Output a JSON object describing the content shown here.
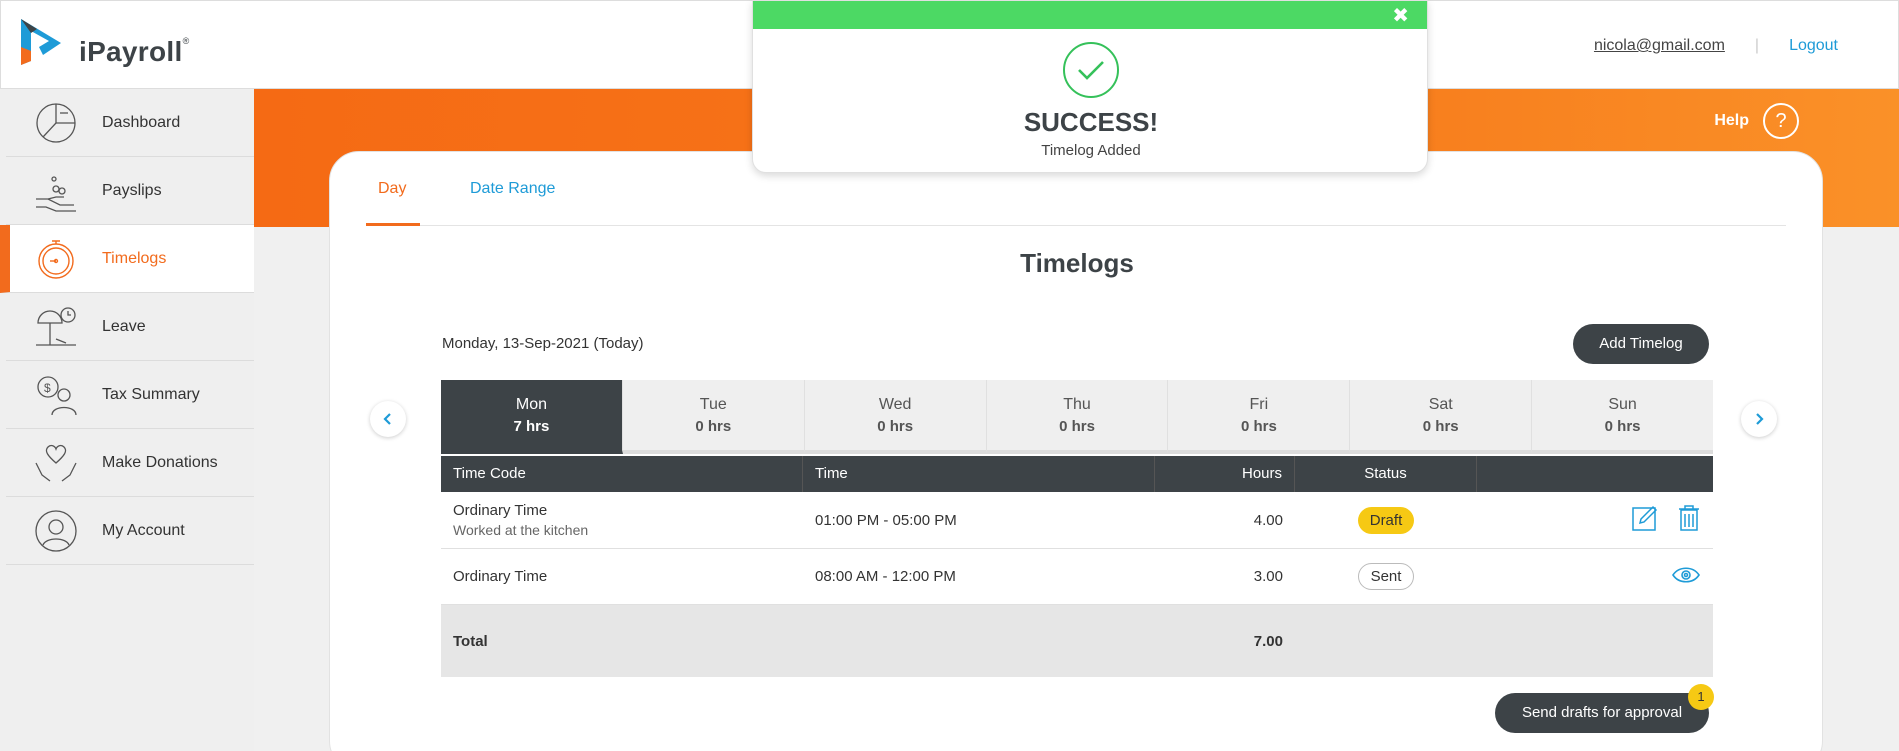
{
  "header": {
    "logo_text": "iPayroll",
    "logo_mark": "®",
    "email": "nicola@gmail.com",
    "separator": "|",
    "logout": "Logout"
  },
  "sidebar": {
    "items": [
      {
        "label": "Dashboard",
        "icon": "pie-chart-icon"
      },
      {
        "label": "Payslips",
        "icon": "hand-coins-icon"
      },
      {
        "label": "Timelogs",
        "icon": "stopwatch-icon",
        "active": true
      },
      {
        "label": "Leave",
        "icon": "beach-umbrella-icon"
      },
      {
        "label": "Tax Summary",
        "icon": "tax-person-icon"
      },
      {
        "label": "Make Donations",
        "icon": "heart-hands-icon"
      },
      {
        "label": "My Account",
        "icon": "user-circle-icon"
      }
    ]
  },
  "banner": {
    "help": "Help",
    "help_icon": "?"
  },
  "tabs": {
    "day": "Day",
    "date_range": "Date Range"
  },
  "main": {
    "title": "Timelogs",
    "date": "Monday, 13-Sep-2021 (Today)",
    "add_button": "Add Timelog",
    "prev_arrow": "‹",
    "next_arrow": "›"
  },
  "week": [
    {
      "day": "Mon",
      "hrs": "7 hrs",
      "active": true
    },
    {
      "day": "Tue",
      "hrs": "0 hrs"
    },
    {
      "day": "Wed",
      "hrs": "0 hrs"
    },
    {
      "day": "Thu",
      "hrs": "0 hrs"
    },
    {
      "day": "Fri",
      "hrs": "0 hrs"
    },
    {
      "day": "Sat",
      "hrs": "0 hrs"
    },
    {
      "day": "Sun",
      "hrs": "0 hrs"
    }
  ],
  "table": {
    "headers": {
      "time_code": "Time Code",
      "time": "Time",
      "hours": "Hours",
      "status": "Status"
    },
    "rows": [
      {
        "time_code": "Ordinary Time",
        "note": "Worked at the kitchen",
        "time": "01:00 PM - 05:00 PM",
        "hours": "4.00",
        "status": "Draft"
      },
      {
        "time_code": "Ordinary Time",
        "note": "",
        "time": "08:00 AM - 12:00 PM",
        "hours": "3.00",
        "status": "Sent"
      }
    ],
    "total_label": "Total",
    "total_hours": "7.00"
  },
  "send": {
    "label": "Send drafts for approval",
    "count": "1"
  },
  "toast": {
    "close": "✖",
    "title": "SUCCESS!",
    "message": "Timelog Added"
  },
  "colors": {
    "accent": "#f26b1d",
    "link": "#1e9bd7",
    "dark": "#3d4347",
    "success": "#4cd964",
    "draft": "#f6c914"
  }
}
